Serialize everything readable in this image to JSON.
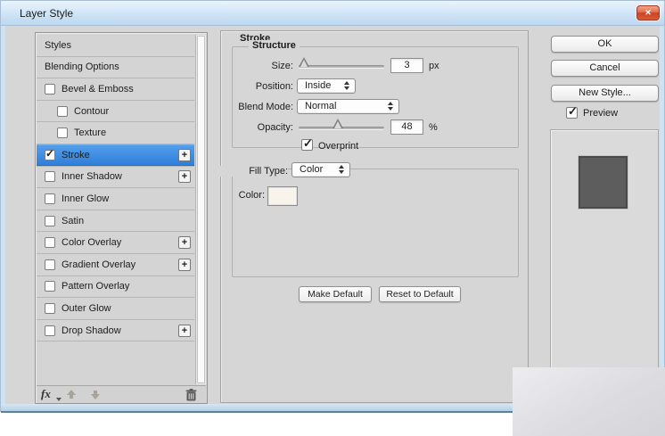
{
  "window": {
    "title": "Layer Style",
    "close_glyph": "✕"
  },
  "colors": {
    "dialog_bg": "#d6d6d6",
    "selection_blue": "#3a87e0",
    "titlebar_blue": "#cfe4f7",
    "close_red": "#d65c35",
    "preview_square": "#5d5d5d",
    "stroke_color_swatch": "#f8f4eb"
  },
  "sidebar": {
    "items": [
      {
        "label": "Styles",
        "check": ""
      },
      {
        "label": "Blending Options",
        "check": ""
      },
      {
        "label": "Bevel & Emboss",
        "check": ""
      },
      {
        "label": "Contour",
        "check": ""
      },
      {
        "label": "Texture",
        "check": ""
      },
      {
        "label": "Stroke",
        "check": "✓",
        "add": "+"
      },
      {
        "label": "Inner Shadow",
        "check": "",
        "add": "+"
      },
      {
        "label": "Inner Glow",
        "check": ""
      },
      {
        "label": "Satin",
        "check": ""
      },
      {
        "label": "Color Overlay",
        "check": "",
        "add": "+"
      },
      {
        "label": "Gradient Overlay",
        "check": "",
        "add": "+"
      },
      {
        "label": "Pattern Overlay",
        "check": ""
      },
      {
        "label": "Outer Glow",
        "check": ""
      },
      {
        "label": "Drop Shadow",
        "check": "",
        "add": "+"
      }
    ],
    "footer": {
      "fx": "fx"
    }
  },
  "main": {
    "panel_title": "Stroke",
    "structure": {
      "legend": "Structure",
      "size_label": "Size:",
      "size_value": "3",
      "size_unit": "px",
      "size_percent": 3,
      "position_label": "Position:",
      "position_value": "Inside",
      "blend_label": "Blend Mode:",
      "blend_value": "Normal",
      "opacity_label": "Opacity:",
      "opacity_value": "48",
      "opacity_unit": "%",
      "opacity_percent": 45,
      "overprint_label": "Overprint",
      "overprint_check": "✓"
    },
    "fill": {
      "type_label": "Fill Type:",
      "type_value": "Color",
      "color_label": "Color:"
    },
    "make_default": "Make Default",
    "reset_default": "Reset to Default"
  },
  "actions": {
    "ok": "OK",
    "cancel": "Cancel",
    "new_style": "New Style...",
    "preview_label": "Preview",
    "preview_check": "✓"
  }
}
